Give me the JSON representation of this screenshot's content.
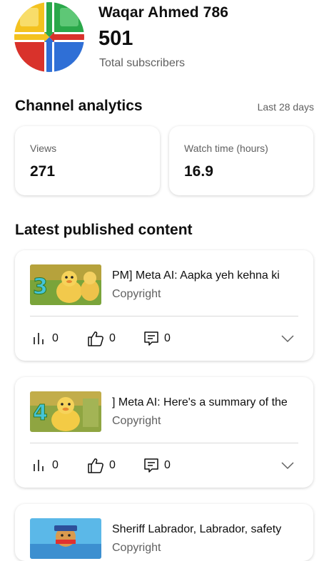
{
  "channel": {
    "name": "Waqar Ahmed 786",
    "subscribers": "501",
    "subscribers_label": "Total subscribers"
  },
  "analytics": {
    "title": "Channel analytics",
    "range": "Last 28 days",
    "views_label": "Views",
    "views_value": "271",
    "watch_label": "Watch time (hours)",
    "watch_value": "16.9"
  },
  "latest": {
    "title": "Latest published content",
    "items": [
      {
        "title": "PM] Meta AI: Aapka yeh kehna ki",
        "status": "Copyright",
        "views": "0",
        "likes": "0",
        "comments": "0",
        "thumb_number": "3"
      },
      {
        "title": "] Meta AI: Here's a  summary of the",
        "status": "Copyright",
        "views": "0",
        "likes": "0",
        "comments": "0",
        "thumb_number": "4"
      },
      {
        "title": "Sheriff Labrador, Labrador, safety",
        "status": "Copyright",
        "views": "",
        "likes": "",
        "comments": "",
        "thumb_number": ""
      }
    ]
  },
  "colors": {
    "text_primary": "#0f0f0f",
    "text_secondary": "#606060",
    "divider": "#d9d9d9"
  }
}
